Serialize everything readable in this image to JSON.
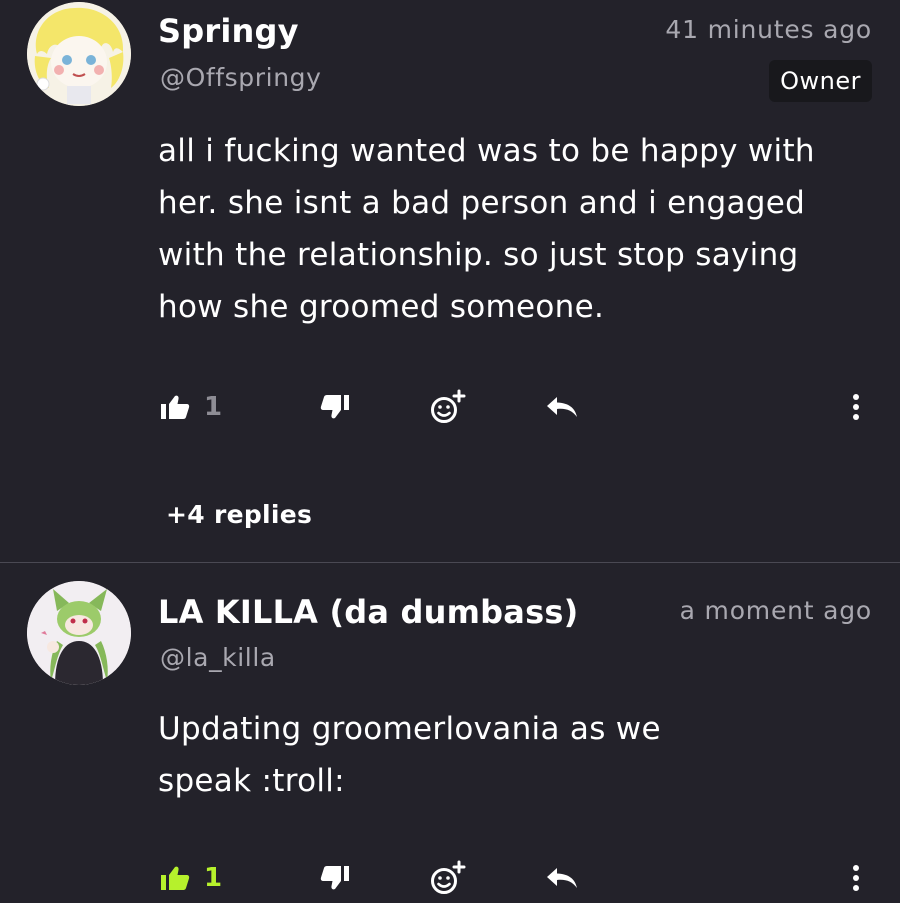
{
  "comments": [
    {
      "author": "Springy",
      "handle": "@Offspringy",
      "time": "41 minutes ago",
      "badge": "Owner",
      "lines": [
        "all i fucking wanted was to be happy with",
        "her. she isnt a bad person and i engaged",
        "with the relationship. so just stop saying",
        "how she groomed someone."
      ],
      "likes": "1",
      "liked": false,
      "replies": "+4 replies"
    },
    {
      "author": "LA KILLA (da dumbass)",
      "handle": "@la_killa",
      "time": "a moment ago",
      "lines": [
        "Updating groomerlovania as we",
        "speak :troll:"
      ],
      "likes": "1",
      "liked": true
    }
  ],
  "colors": {
    "background": "#23222a",
    "accent_like": "#b6f12c",
    "muted": "#a9a8b0"
  },
  "icons": [
    "thumbs-up-icon",
    "thumbs-down-icon",
    "add-reaction-icon",
    "reply-arrow-icon",
    "more-vertical-icon"
  ]
}
